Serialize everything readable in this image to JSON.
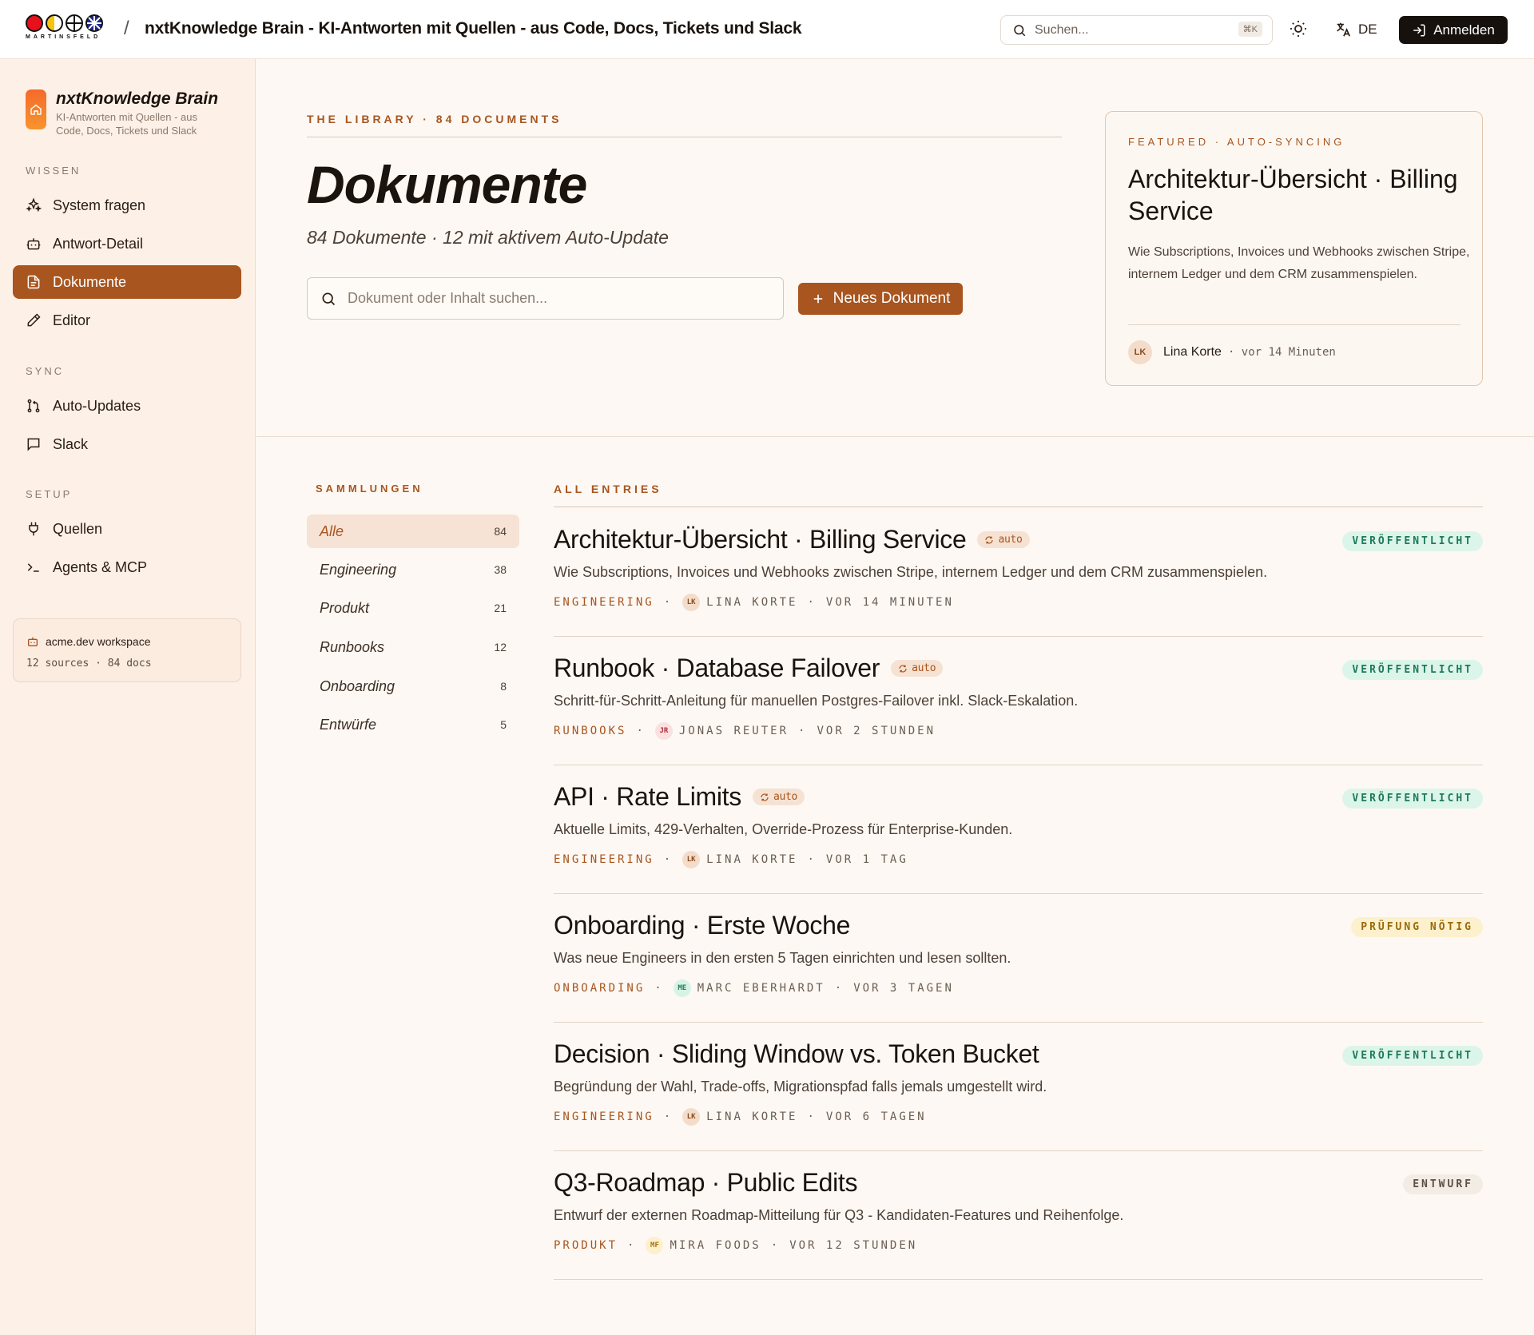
{
  "header": {
    "brand_word": "MARTINSFELD",
    "separator": "/",
    "app_title": "nxtKnowledge Brain - KI-Antworten mit Quellen - aus Code, Docs, Tickets und Slack",
    "search_placeholder": "Suchen...",
    "search_shortcut": "⌘K",
    "language": "DE",
    "login_label": "Anmelden"
  },
  "sidebar": {
    "brand_name": "nxtKnowledge Brain",
    "brand_sub": "KI-Antworten mit Quellen - aus Code, Docs, Tickets und Slack",
    "sections": {
      "wissen": "WISSEN",
      "sync": "SYNC",
      "setup": "SETUP"
    },
    "items": [
      {
        "label": "System fragen",
        "icon": "sparkles-icon"
      },
      {
        "label": "Antwort-Detail",
        "icon": "bot-icon"
      },
      {
        "label": "Dokumente",
        "icon": "document-icon",
        "active": true
      },
      {
        "label": "Editor",
        "icon": "pencil-icon"
      },
      {
        "label": "Auto-Updates",
        "icon": "git-branch-icon"
      },
      {
        "label": "Slack",
        "icon": "chat-icon"
      },
      {
        "label": "Quellen",
        "icon": "plug-icon"
      },
      {
        "label": "Agents & MCP",
        "icon": "terminal-icon"
      }
    ],
    "workspace": {
      "title": "acme.dev workspace",
      "stats": "12 sources · 84 docs"
    }
  },
  "main": {
    "eyebrow": "THE LIBRARY · 84 DOCUMENTS",
    "title": "Dokumente",
    "subtitle": "84 Dokumente · 12 mit aktivem Auto-Update",
    "search_placeholder": "Dokument oder Inhalt suchen...",
    "new_button": "Neues Dokument",
    "featured": {
      "eyebrow": "FEATURED · AUTO-SYNCING",
      "title": "Architektur-Übersicht · Billing Service",
      "description": "Wie Subscriptions, Invoices und Webhooks zwischen Stripe, internem Ledger und dem CRM zusammenspielen.",
      "author_initials": "LK",
      "author": "Lina Korte",
      "time": "· vor 14 Minuten"
    }
  },
  "collections": {
    "heading": "SAMMLUNGEN",
    "items": [
      {
        "label": "Alle",
        "count": "84",
        "active": true
      },
      {
        "label": "Engineering",
        "count": "38"
      },
      {
        "label": "Produkt",
        "count": "21"
      },
      {
        "label": "Runbooks",
        "count": "12"
      },
      {
        "label": "Onboarding",
        "count": "8"
      },
      {
        "label": "Entwürfe",
        "count": "5"
      }
    ]
  },
  "entries": {
    "heading": "ALL ENTRIES",
    "auto_label": "auto",
    "dot": "·",
    "items": [
      {
        "title": "Architektur-Übersicht · Billing Service",
        "auto": true,
        "description": "Wie Subscriptions, Invoices und Webhooks zwischen Stripe, internem Ledger und dem CRM zusammenspielen.",
        "collection": "ENGINEERING",
        "initials": "LK",
        "author": "LINA KORTE",
        "time": "VOR 14 MINUTEN",
        "status": "VERÖFFENTLICHT",
        "status_kind": "published",
        "avatar_bg": "#f4dccb",
        "avatar_fg": "#8b4a1e"
      },
      {
        "title": "Runbook · Database Failover",
        "auto": true,
        "description": "Schritt-für-Schritt-Anleitung für manuellen Postgres-Failover inkl. Slack-Eskalation.",
        "collection": "RUNBOOKS",
        "initials": "JR",
        "author": "JONAS REUTER",
        "time": "VOR 2 STUNDEN",
        "status": "VERÖFFENTLICHT",
        "status_kind": "published",
        "avatar_bg": "#fbe0e0",
        "avatar_fg": "#b0303a"
      },
      {
        "title": "API · Rate Limits",
        "auto": true,
        "description": "Aktuelle Limits, 429-Verhalten, Override-Prozess für Enterprise-Kunden.",
        "collection": "ENGINEERING",
        "initials": "LK",
        "author": "LINA KORTE",
        "time": "VOR 1 TAG",
        "status": "VERÖFFENTLICHT",
        "status_kind": "published",
        "avatar_bg": "#f4dccb",
        "avatar_fg": "#8b4a1e"
      },
      {
        "title": "Onboarding · Erste Woche",
        "auto": false,
        "description": "Was neue Engineers in den ersten 5 Tagen einrichten und lesen sollten.",
        "collection": "ONBOARDING",
        "initials": "ME",
        "author": "MARC EBERHARDT",
        "time": "VOR 3 TAGEN",
        "status": "PRÜFUNG NÖTIG",
        "status_kind": "review",
        "avatar_bg": "#d7f3e6",
        "avatar_fg": "#1f7a57"
      },
      {
        "title": "Decision · Sliding Window vs. Token Bucket",
        "auto": false,
        "description": "Begründung der Wahl, Trade-offs, Migrationspfad falls jemals umgestellt wird.",
        "collection": "ENGINEERING",
        "initials": "LK",
        "author": "LINA KORTE",
        "time": "VOR 6 TAGEN",
        "status": "VERÖFFENTLICHT",
        "status_kind": "published",
        "avatar_bg": "#f4dccb",
        "avatar_fg": "#8b4a1e"
      },
      {
        "title": "Q3-Roadmap · Public Edits",
        "auto": false,
        "description": "Entwurf der externen Roadmap-Mitteilung für Q3 - Kandidaten-Features und Reihenfolge.",
        "collection": "PRODUKT",
        "initials": "MF",
        "author": "MIRA FOODS",
        "time": "VOR 12 STUNDEN",
        "status": "ENTWURF",
        "status_kind": "draft",
        "avatar_bg": "#fdf0cc",
        "avatar_fg": "#b06d10"
      }
    ]
  },
  "colors": {
    "accent": "#a8551f",
    "published": "#1f7a57",
    "review": "#9a6a0a"
  }
}
